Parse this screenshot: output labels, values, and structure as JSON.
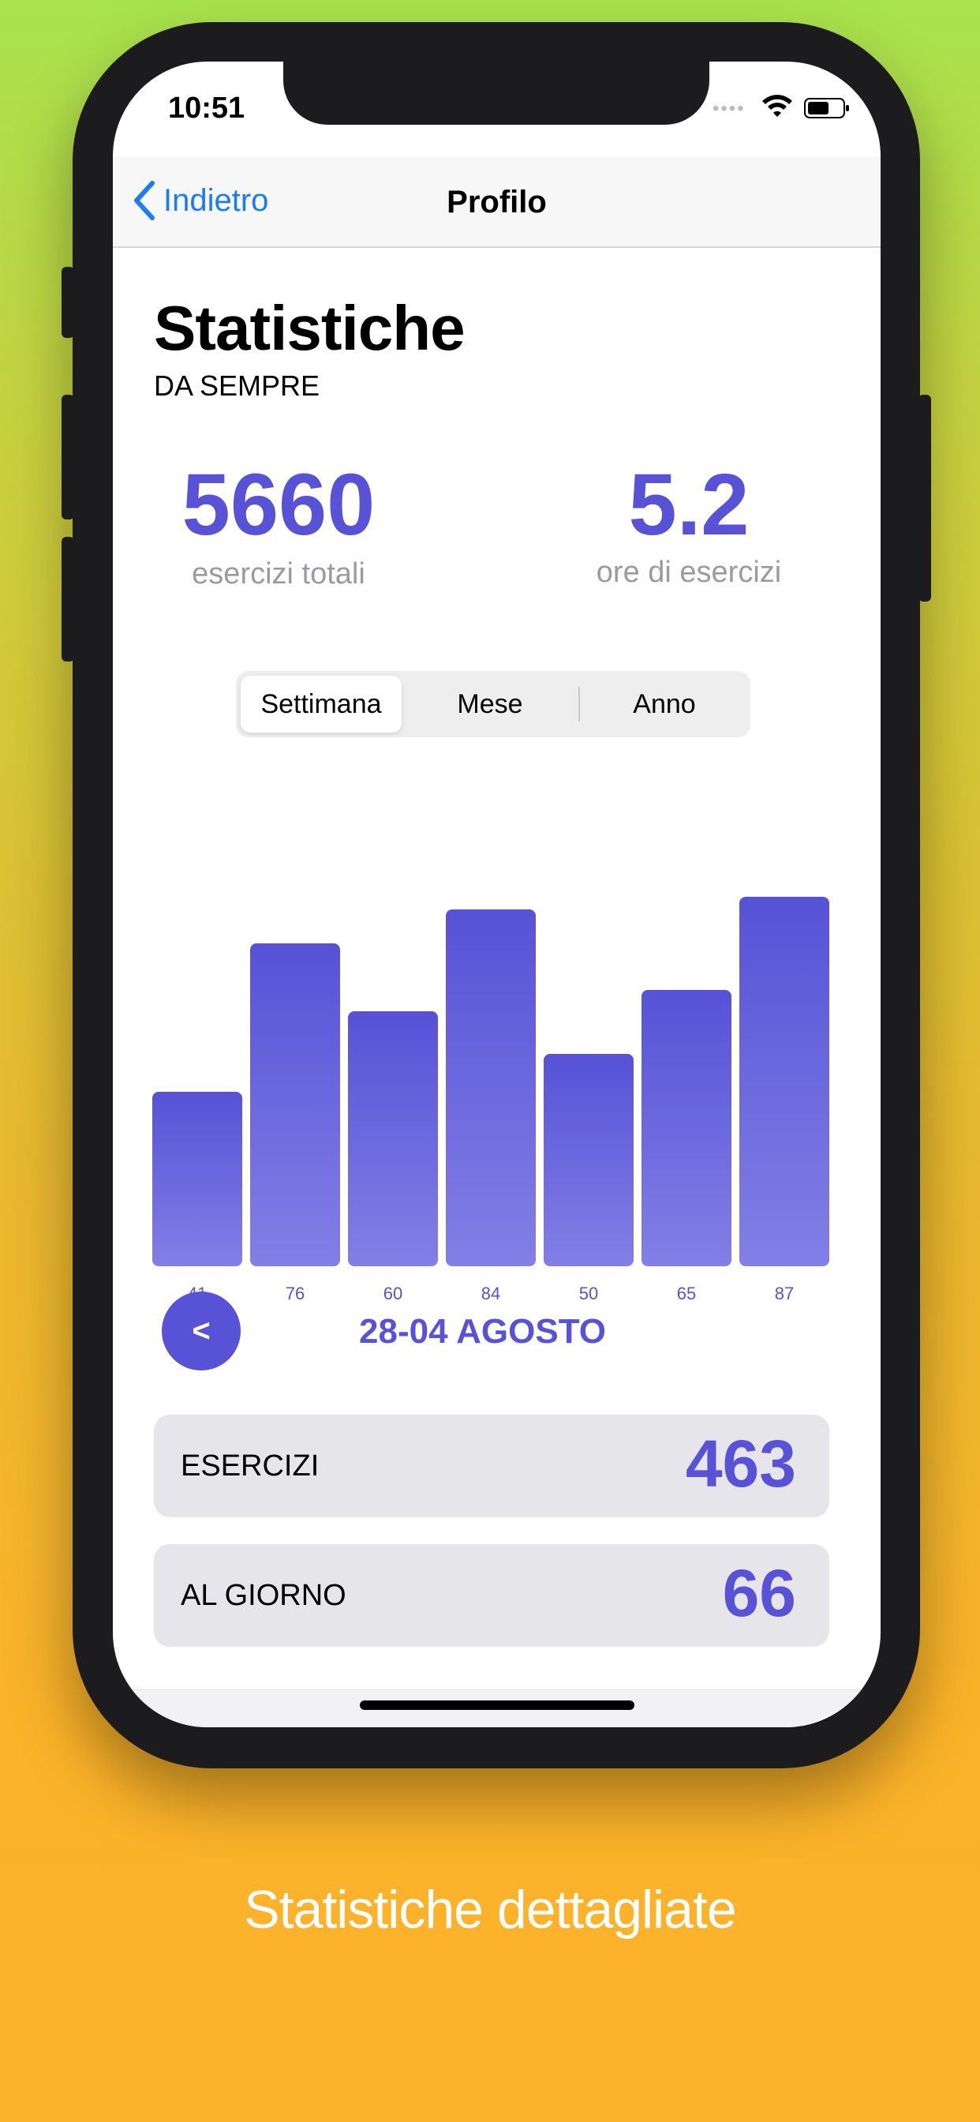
{
  "status_bar": {
    "time": "10:51"
  },
  "nav": {
    "back_label": "Indietro",
    "title": "Profilo",
    "back_icon": "chevron-left-icon"
  },
  "stats": {
    "title": "Statistiche",
    "subtitle": "DA SEMPRE",
    "total_exercises": "5660",
    "total_exercises_label": "esercizi totali",
    "hours": "5.2",
    "hours_label": "ore di esercizi"
  },
  "segments": {
    "items": [
      "Settimana",
      "Mese",
      "Anno"
    ],
    "selected": "Settimana"
  },
  "chart_data": {
    "type": "bar",
    "categories": [
      "41",
      "76",
      "60",
      "84",
      "50",
      "65",
      "87"
    ],
    "values": [
      41,
      76,
      60,
      84,
      50,
      65,
      87
    ],
    "ylim": [
      0,
      87
    ],
    "grid": false,
    "bar_color": "#5752d6"
  },
  "week": {
    "prev_label": "<",
    "range": "28-04 AGOSTO"
  },
  "summary": {
    "exercises_label": "ESERCIZI",
    "exercises_value": "463",
    "per_day_label": "AL GIORNO",
    "per_day_value": "66"
  },
  "caption": "Statistiche dettagliate",
  "colors": {
    "accent": "#5752d6",
    "link": "#1e7cf2"
  }
}
